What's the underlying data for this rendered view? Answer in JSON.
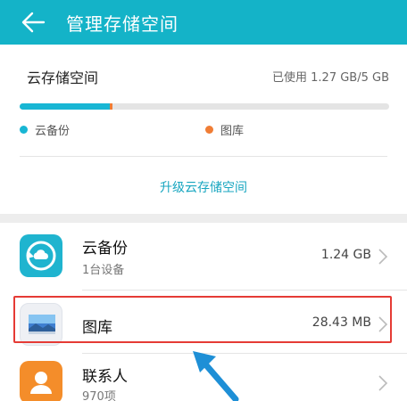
{
  "header": {
    "title": "管理存储空间",
    "back_icon": "back-arrow-icon"
  },
  "storage": {
    "title": "云存储空间",
    "used_text": "已使用 1.27 GB/5 GB",
    "bar": {
      "cloud_fraction": 0.245,
      "gallery_fraction": 0.006
    },
    "legend": [
      {
        "label": "云备份",
        "color": "#18b6d4"
      },
      {
        "label": "图库",
        "color": "#f07d35"
      }
    ],
    "upgrade_label": "升级云存储空间"
  },
  "items": [
    {
      "name": "云备份",
      "sub": "1台设备",
      "size": "1.24 GB",
      "icon": "cloud-backup-icon"
    },
    {
      "name": "图库",
      "sub": "",
      "size": "28.43 MB",
      "icon": "gallery-icon"
    },
    {
      "name": "联系人",
      "sub": "970项",
      "size": "",
      "icon": "contacts-icon"
    }
  ],
  "colors": {
    "header": "#14b3c8",
    "accent": "#18a6c0",
    "highlight": "#e53b35",
    "annotation_arrow": "#1e8fd6"
  }
}
